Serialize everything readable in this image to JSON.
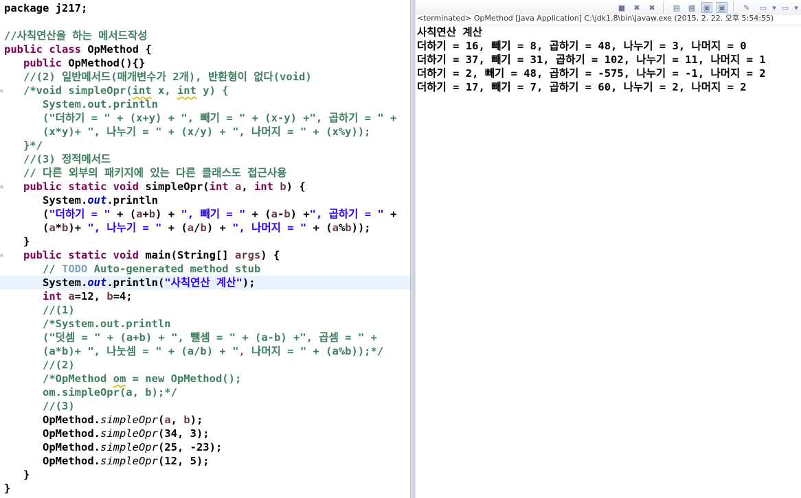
{
  "editor": {
    "lines": [
      {
        "spans": [
          {
            "t": "package j217;",
            "c": ""
          }
        ]
      },
      {
        "spans": []
      },
      {
        "spans": [
          {
            "t": "//사칙연산을 하는 메서드작성",
            "c": "cm"
          }
        ]
      },
      {
        "spans": [
          {
            "t": "public class ",
            "c": "kw"
          },
          {
            "t": "OpMethod {",
            "c": ""
          }
        ]
      },
      {
        "spans": [
          {
            "t": "   public ",
            "c": "kw"
          },
          {
            "t": "OpMethod(){}",
            "c": ""
          }
        ]
      },
      {
        "spans": [
          {
            "t": "   //(2) 일반메서드(매개변수가 2개), 반환형이 없다(void)",
            "c": "cm"
          }
        ]
      },
      {
        "spans": [
          {
            "t": "   /*void simpleOpr(",
            "c": "cm"
          },
          {
            "t": "int",
            "c": "cm warn"
          },
          {
            "t": " x, ",
            "c": "cm"
          },
          {
            "t": "int",
            "c": "cm warn"
          },
          {
            "t": " y) {",
            "c": "cm"
          }
        ]
      },
      {
        "spans": [
          {
            "t": "      System.out.println",
            "c": "cm"
          }
        ]
      },
      {
        "spans": [
          {
            "t": "      (\"더하기 = \" + (x+y) + \", 빼기 = \" + (x-y) +\", 곱하기 = \" +",
            "c": "cm"
          }
        ]
      },
      {
        "spans": [
          {
            "t": "      (x*y)+ \", 나누기 = \" + (x/y) + \", 나머지 = \" + (x%y));",
            "c": "cm"
          }
        ]
      },
      {
        "spans": [
          {
            "t": "   }*/",
            "c": "cm"
          }
        ]
      },
      {
        "spans": [
          {
            "t": "   //(3) 정적메서드",
            "c": "cm"
          }
        ]
      },
      {
        "spans": [
          {
            "t": "   // 다른 외부의 패키지에 있는 다른 클래스도 접근사용",
            "c": "cm"
          }
        ]
      },
      {
        "spans": [
          {
            "t": "   public static void ",
            "c": "kw"
          },
          {
            "t": "simpleOpr(",
            "c": ""
          },
          {
            "t": "int ",
            "c": "kw"
          },
          {
            "t": "a",
            "c": "var"
          },
          {
            "t": ", ",
            "c": ""
          },
          {
            "t": "int ",
            "c": "kw"
          },
          {
            "t": "b",
            "c": "var"
          },
          {
            "t": ") {",
            "c": ""
          }
        ]
      },
      {
        "spans": [
          {
            "t": "      System.",
            "c": ""
          },
          {
            "t": "out",
            "c": "fld"
          },
          {
            "t": ".println",
            "c": ""
          }
        ]
      },
      {
        "spans": [
          {
            "t": "      (",
            "c": ""
          },
          {
            "t": "\"더하기 = \"",
            "c": "str"
          },
          {
            "t": " + (",
            "c": ""
          },
          {
            "t": "a",
            "c": "var"
          },
          {
            "t": "+",
            "c": ""
          },
          {
            "t": "b",
            "c": "var"
          },
          {
            "t": ") + ",
            "c": ""
          },
          {
            "t": "\", 빼기 = \"",
            "c": "str"
          },
          {
            "t": " + (",
            "c": ""
          },
          {
            "t": "a",
            "c": "var"
          },
          {
            "t": "-",
            "c": ""
          },
          {
            "t": "b",
            "c": "var"
          },
          {
            "t": ") +",
            "c": ""
          },
          {
            "t": "\", 곱하기 = \"",
            "c": "str"
          },
          {
            "t": " +",
            "c": ""
          }
        ]
      },
      {
        "spans": [
          {
            "t": "      (",
            "c": ""
          },
          {
            "t": "a",
            "c": "var"
          },
          {
            "t": "*",
            "c": ""
          },
          {
            "t": "b",
            "c": "var"
          },
          {
            "t": ")+ ",
            "c": ""
          },
          {
            "t": "\", 나누기 = \"",
            "c": "str"
          },
          {
            "t": " + (",
            "c": ""
          },
          {
            "t": "a",
            "c": "var"
          },
          {
            "t": "/",
            "c": ""
          },
          {
            "t": "b",
            "c": "var"
          },
          {
            "t": ") + ",
            "c": ""
          },
          {
            "t": "\", 나머지 = \"",
            "c": "str"
          },
          {
            "t": " + (",
            "c": ""
          },
          {
            "t": "a",
            "c": "var"
          },
          {
            "t": "%",
            "c": ""
          },
          {
            "t": "b",
            "c": "var"
          },
          {
            "t": "));",
            "c": ""
          }
        ]
      },
      {
        "spans": [
          {
            "t": "   }",
            "c": ""
          }
        ]
      },
      {
        "spans": [
          {
            "t": "   public static void ",
            "c": "kw"
          },
          {
            "t": "main(String[] ",
            "c": ""
          },
          {
            "t": "args",
            "c": "var"
          },
          {
            "t": ") {",
            "c": ""
          }
        ]
      },
      {
        "spans": [
          {
            "t": "      // ",
            "c": "cm"
          },
          {
            "t": "TODO",
            "c": "todo"
          },
          {
            "t": " Auto-generated method stub",
            "c": "cm"
          }
        ]
      },
      {
        "spans": [
          {
            "t": "      System.",
            "c": ""
          },
          {
            "t": "out",
            "c": "fld"
          },
          {
            "t": ".println(",
            "c": ""
          },
          {
            "t": "\"사칙연산 계산\"",
            "c": "str"
          },
          {
            "t": ");",
            "c": ""
          }
        ],
        "current": true
      },
      {
        "spans": [
          {
            "t": "      int ",
            "c": "kw"
          },
          {
            "t": "a",
            "c": "var"
          },
          {
            "t": "=12, ",
            "c": ""
          },
          {
            "t": "b",
            "c": "var"
          },
          {
            "t": "=4;",
            "c": ""
          }
        ]
      },
      {
        "spans": [
          {
            "t": "      //(1)",
            "c": "cm"
          }
        ]
      },
      {
        "spans": [
          {
            "t": "      /*System.out.println",
            "c": "cm"
          }
        ]
      },
      {
        "spans": [
          {
            "t": "      (\"덧셈 = \" + (a+b) + \", 뺄셈 = \" + (a-b) +\", 곱셈 = \" +",
            "c": "cm"
          }
        ]
      },
      {
        "spans": [
          {
            "t": "      (a*b)+ \", 나눗셈 = \" + (a/b) + \", 나머지 = \" + (a%b));*/",
            "c": "cm"
          }
        ]
      },
      {
        "spans": [
          {
            "t": "      //(2)",
            "c": "cm"
          }
        ]
      },
      {
        "spans": [
          {
            "t": "      /*OpMethod ",
            "c": "cm"
          },
          {
            "t": "om",
            "c": "cm warn"
          },
          {
            "t": " = new OpMethod();",
            "c": "cm"
          }
        ]
      },
      {
        "spans": [
          {
            "t": "      om.simpleOpr(a, b);*/",
            "c": "cm"
          }
        ]
      },
      {
        "spans": [
          {
            "t": "      //(3)",
            "c": "cm"
          }
        ]
      },
      {
        "spans": [
          {
            "t": "      OpMethod.",
            "c": ""
          },
          {
            "t": "simpleOpr",
            "c": "st"
          },
          {
            "t": "(",
            "c": ""
          },
          {
            "t": "a",
            "c": "var"
          },
          {
            "t": ", ",
            "c": ""
          },
          {
            "t": "b",
            "c": "var"
          },
          {
            "t": ");",
            "c": ""
          }
        ]
      },
      {
        "spans": [
          {
            "t": "      OpMethod.",
            "c": ""
          },
          {
            "t": "simpleOpr",
            "c": "st"
          },
          {
            "t": "(34, 3);",
            "c": ""
          }
        ]
      },
      {
        "spans": [
          {
            "t": "      OpMethod.",
            "c": ""
          },
          {
            "t": "simpleOpr",
            "c": "st"
          },
          {
            "t": "(25, -23);",
            "c": ""
          }
        ]
      },
      {
        "spans": [
          {
            "t": "      OpMethod.",
            "c": ""
          },
          {
            "t": "simpleOpr",
            "c": "st"
          },
          {
            "t": "(12, 5);",
            "c": ""
          }
        ]
      },
      {
        "spans": [
          {
            "t": "   }",
            "c": ""
          }
        ]
      },
      {
        "spans": [
          {
            "t": "}",
            "c": ""
          }
        ]
      }
    ]
  },
  "console": {
    "status": "<terminated> OpMethod [Java Application] C:\\jdk1.8\\bin\\javaw.exe (2015. 2. 22. 오후 5:54:55)",
    "toolbar_icons": [
      "terminate-icon",
      "remove-launch-icon",
      "remove-all-icon",
      "clear-console-icon",
      "scroll-lock-icon",
      "pin-console-icon",
      "word-wrap-icon",
      "show-on-output-icon",
      "open-console-icon",
      "display-console-icon"
    ],
    "output": [
      "사칙연산 계산",
      "더하기 = 16, 빼기 = 8, 곱하기 = 48, 나누기 = 3, 나머지 = 0",
      "더하기 = 37, 빼기 = 31, 곱하기 = 102, 나누기 = 11, 나머지 = 1",
      "더하기 = 2, 빼기 = 48, 곱하기 = -575, 나누기 = -1, 나머지 = 2",
      "더하기 = 17, 빼기 = 7, 곱하기 = 60, 나누기 = 2, 나머지 = 2"
    ]
  }
}
